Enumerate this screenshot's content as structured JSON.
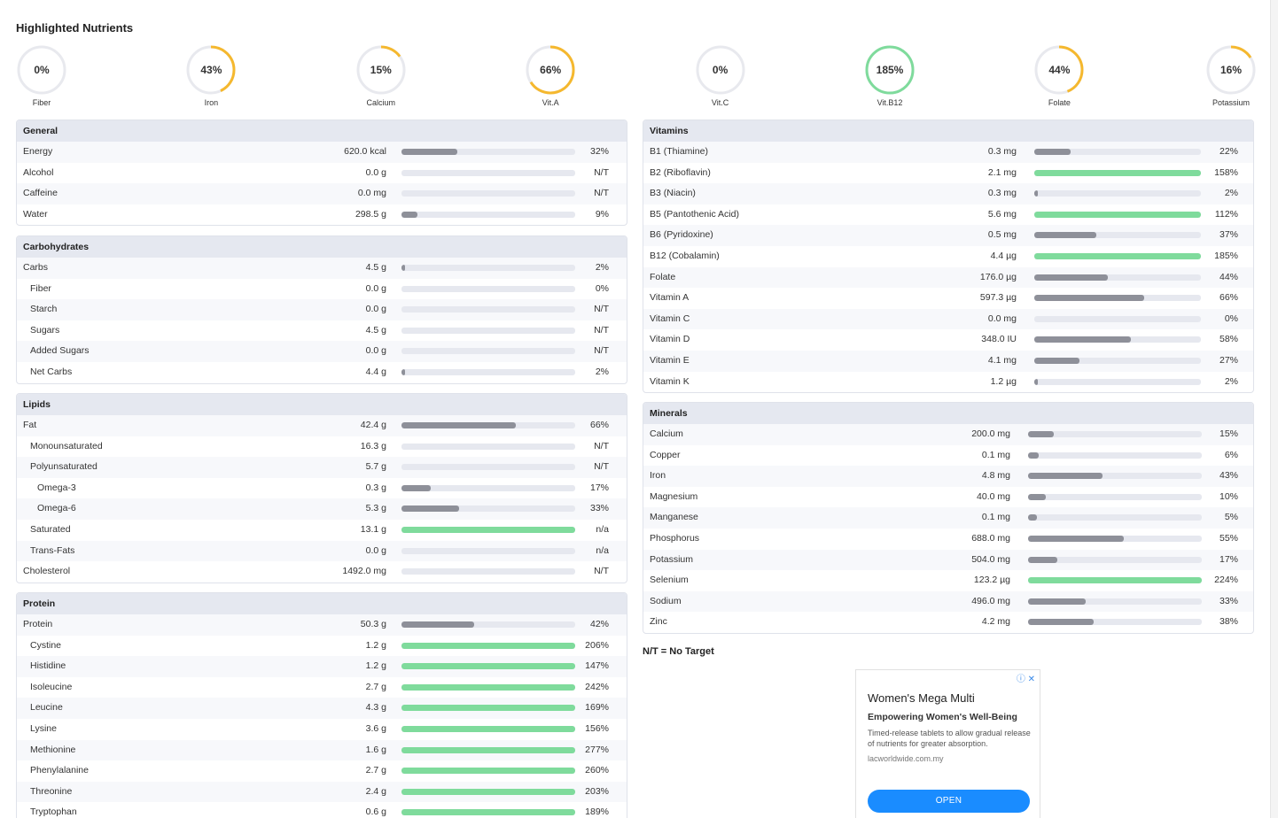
{
  "title": "Highlighted Nutrients",
  "highlighted": [
    {
      "label": "Fiber",
      "percent_text": "0%",
      "value": 0
    },
    {
      "label": "Iron",
      "percent_text": "43%",
      "value": 43
    },
    {
      "label": "Calcium",
      "percent_text": "15%",
      "value": 15
    },
    {
      "label": "Vit.A",
      "percent_text": "66%",
      "value": 66
    },
    {
      "label": "Vit.C",
      "percent_text": "0%",
      "value": 0
    },
    {
      "label": "Vit.B12",
      "percent_text": "185%",
      "value": 185
    },
    {
      "label": "Folate",
      "percent_text": "44%",
      "value": 44
    },
    {
      "label": "Potassium",
      "percent_text": "16%",
      "value": 16
    }
  ],
  "colors": {
    "under_target": "#f5b82e",
    "over_target": "#7fdb9c",
    "ring_track": "#e8e9ee",
    "bar_fill": "#8e9099",
    "bar_over": "#7fdb9c"
  },
  "panels": {
    "general": {
      "title": "General",
      "rows": [
        {
          "name": "Energy",
          "indent": 0,
          "amount": "620.0 kcal",
          "fill": 32,
          "pct": "32%"
        },
        {
          "name": "Alcohol",
          "indent": 0,
          "amount": "0.0 g",
          "fill": 0,
          "pct": "N/T"
        },
        {
          "name": "Caffeine",
          "indent": 0,
          "amount": "0.0 mg",
          "fill": 0,
          "pct": "N/T"
        },
        {
          "name": "Water",
          "indent": 0,
          "amount": "298.5 g",
          "fill": 9,
          "pct": "9%"
        }
      ]
    },
    "carbohydrates": {
      "title": "Carbohydrates",
      "rows": [
        {
          "name": "Carbs",
          "indent": 0,
          "amount": "4.5 g",
          "fill": 2,
          "pct": "2%"
        },
        {
          "name": "Fiber",
          "indent": 1,
          "amount": "0.0 g",
          "fill": 0,
          "pct": "0%"
        },
        {
          "name": "Starch",
          "indent": 1,
          "amount": "0.0 g",
          "fill": 0,
          "pct": "N/T"
        },
        {
          "name": "Sugars",
          "indent": 1,
          "amount": "4.5 g",
          "fill": 0,
          "pct": "N/T"
        },
        {
          "name": "Added Sugars",
          "indent": 1,
          "amount": "0.0 g",
          "fill": 0,
          "pct": "N/T"
        },
        {
          "name": "Net Carbs",
          "indent": 1,
          "amount": "4.4 g",
          "fill": 2,
          "pct": "2%"
        }
      ]
    },
    "lipids": {
      "title": "Lipids",
      "rows": [
        {
          "name": "Fat",
          "indent": 0,
          "amount": "42.4 g",
          "fill": 66,
          "pct": "66%"
        },
        {
          "name": "Monounsaturated",
          "indent": 1,
          "amount": "16.3 g",
          "fill": 0,
          "pct": "N/T"
        },
        {
          "name": "Polyunsaturated",
          "indent": 1,
          "amount": "5.7 g",
          "fill": 0,
          "pct": "N/T"
        },
        {
          "name": "Omega-3",
          "indent": 2,
          "amount": "0.3 g",
          "fill": 17,
          "pct": "17%"
        },
        {
          "name": "Omega-6",
          "indent": 2,
          "amount": "5.3 g",
          "fill": 33,
          "pct": "33%"
        },
        {
          "name": "Saturated",
          "indent": 1,
          "amount": "13.1 g",
          "fill": 100,
          "pct": "n/a",
          "over": true
        },
        {
          "name": "Trans-Fats",
          "indent": 1,
          "amount": "0.0 g",
          "fill": 0,
          "pct": "n/a"
        },
        {
          "name": "Cholesterol",
          "indent": 0,
          "amount": "1492.0 mg",
          "fill": 0,
          "pct": "N/T"
        }
      ]
    },
    "protein": {
      "title": "Protein",
      "rows": [
        {
          "name": "Protein",
          "indent": 0,
          "amount": "50.3 g",
          "fill": 42,
          "pct": "42%"
        },
        {
          "name": "Cystine",
          "indent": 1,
          "amount": "1.2 g",
          "fill": 100,
          "pct": "206%",
          "over": true
        },
        {
          "name": "Histidine",
          "indent": 1,
          "amount": "1.2 g",
          "fill": 100,
          "pct": "147%",
          "over": true
        },
        {
          "name": "Isoleucine",
          "indent": 1,
          "amount": "2.7 g",
          "fill": 100,
          "pct": "242%",
          "over": true
        },
        {
          "name": "Leucine",
          "indent": 1,
          "amount": "4.3 g",
          "fill": 100,
          "pct": "169%",
          "over": true
        },
        {
          "name": "Lysine",
          "indent": 1,
          "amount": "3.6 g",
          "fill": 100,
          "pct": "156%",
          "over": true
        },
        {
          "name": "Methionine",
          "indent": 1,
          "amount": "1.6 g",
          "fill": 100,
          "pct": "277%",
          "over": true
        },
        {
          "name": "Phenylalanine",
          "indent": 1,
          "amount": "2.7 g",
          "fill": 100,
          "pct": "260%",
          "over": true
        },
        {
          "name": "Threonine",
          "indent": 1,
          "amount": "2.4 g",
          "fill": 100,
          "pct": "203%",
          "over": true
        },
        {
          "name": "Tryptophan",
          "indent": 1,
          "amount": "0.6 g",
          "fill": 100,
          "pct": "189%",
          "over": true
        }
      ]
    },
    "vitamins": {
      "title": "Vitamins",
      "rows": [
        {
          "name": "B1 (Thiamine)",
          "indent": 0,
          "amount": "0.3 mg",
          "fill": 22,
          "pct": "22%"
        },
        {
          "name": "B2 (Riboflavin)",
          "indent": 0,
          "amount": "2.1 mg",
          "fill": 100,
          "pct": "158%",
          "over": true
        },
        {
          "name": "B3 (Niacin)",
          "indent": 0,
          "amount": "0.3 mg",
          "fill": 2,
          "pct": "2%"
        },
        {
          "name": "B5 (Pantothenic Acid)",
          "indent": 0,
          "amount": "5.6 mg",
          "fill": 100,
          "pct": "112%",
          "over": true
        },
        {
          "name": "B6 (Pyridoxine)",
          "indent": 0,
          "amount": "0.5 mg",
          "fill": 37,
          "pct": "37%"
        },
        {
          "name": "B12 (Cobalamin)",
          "indent": 0,
          "amount": "4.4 µg",
          "fill": 100,
          "pct": "185%",
          "over": true
        },
        {
          "name": "Folate",
          "indent": 0,
          "amount": "176.0 µg",
          "fill": 44,
          "pct": "44%"
        },
        {
          "name": "Vitamin A",
          "indent": 0,
          "amount": "597.3 µg",
          "fill": 66,
          "pct": "66%"
        },
        {
          "name": "Vitamin C",
          "indent": 0,
          "amount": "0.0 mg",
          "fill": 0,
          "pct": "0%"
        },
        {
          "name": "Vitamin D",
          "indent": 0,
          "amount": "348.0 IU",
          "fill": 58,
          "pct": "58%"
        },
        {
          "name": "Vitamin E",
          "indent": 0,
          "amount": "4.1 mg",
          "fill": 27,
          "pct": "27%"
        },
        {
          "name": "Vitamin K",
          "indent": 0,
          "amount": "1.2 µg",
          "fill": 2,
          "pct": "2%"
        }
      ]
    },
    "minerals": {
      "title": "Minerals",
      "rows": [
        {
          "name": "Calcium",
          "indent": 0,
          "amount": "200.0 mg",
          "fill": 15,
          "pct": "15%"
        },
        {
          "name": "Copper",
          "indent": 0,
          "amount": "0.1 mg",
          "fill": 6,
          "pct": "6%"
        },
        {
          "name": "Iron",
          "indent": 0,
          "amount": "4.8 mg",
          "fill": 43,
          "pct": "43%"
        },
        {
          "name": "Magnesium",
          "indent": 0,
          "amount": "40.0 mg",
          "fill": 10,
          "pct": "10%"
        },
        {
          "name": "Manganese",
          "indent": 0,
          "amount": "0.1 mg",
          "fill": 5,
          "pct": "5%"
        },
        {
          "name": "Phosphorus",
          "indent": 0,
          "amount": "688.0 mg",
          "fill": 55,
          "pct": "55%"
        },
        {
          "name": "Potassium",
          "indent": 0,
          "amount": "504.0 mg",
          "fill": 17,
          "pct": "17%"
        },
        {
          "name": "Selenium",
          "indent": 0,
          "amount": "123.2 µg",
          "fill": 100,
          "pct": "224%",
          "over": true
        },
        {
          "name": "Sodium",
          "indent": 0,
          "amount": "496.0 mg",
          "fill": 33,
          "pct": "33%"
        },
        {
          "name": "Zinc",
          "indent": 0,
          "amount": "4.2 mg",
          "fill": 38,
          "pct": "38%"
        }
      ]
    }
  },
  "legend_note": "N/T = No Target",
  "ad": {
    "headline": "Women's Mega Multi",
    "subheadline": "Empowering Women's Well-Being",
    "description": "Timed-release tablets to allow gradual release of nutrients for greater absorption.",
    "url": "lacworldwide.com.my",
    "cta": "OPEN",
    "info_icon": "info-icon",
    "close_icon": "close-icon"
  }
}
